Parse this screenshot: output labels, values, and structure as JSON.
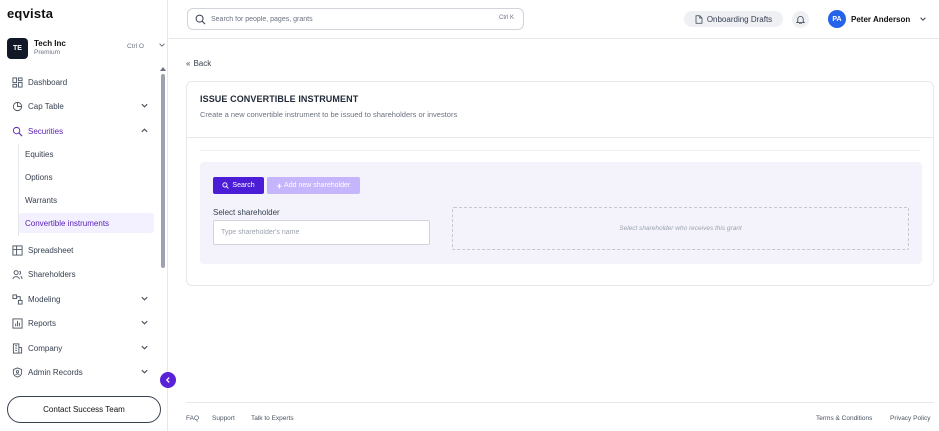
{
  "app": {
    "logo": "eqvista"
  },
  "org": {
    "initials": "TE",
    "name": "Tech Inc",
    "plan": "Premium",
    "shortcut": "Ctrl O"
  },
  "sidebar": {
    "items": [
      {
        "label": "Dashboard",
        "icon": "dashboard-icon"
      },
      {
        "label": "Cap Table",
        "icon": "pie-chart-icon"
      },
      {
        "label": "Securities",
        "icon": "securities-icon"
      },
      {
        "label": "Spreadsheet",
        "icon": "grid-icon"
      },
      {
        "label": "Shareholders",
        "icon": "users-icon"
      },
      {
        "label": "Modeling",
        "icon": "modeling-icon"
      },
      {
        "label": "Reports",
        "icon": "reports-icon"
      },
      {
        "label": "Company",
        "icon": "company-icon"
      },
      {
        "label": "Admin Records",
        "icon": "admin-icon"
      }
    ],
    "securities_sub": [
      "Equities",
      "Options",
      "Warrants",
      "Convertible instruments"
    ],
    "contact_label": "Contact Success Team"
  },
  "topbar": {
    "search_placeholder": "Search for people, pages, grants",
    "search_shortcut": "Ctrl K",
    "drafts_label": "Onboarding Drafts",
    "user_initials": "PA",
    "user_name": "Peter Anderson"
  },
  "main": {
    "back_label": "Back",
    "card": {
      "title": "ISSUE CONVERTIBLE INSTRUMENT",
      "subtitle": "Create a new convertible instrument to be issued to shareholders or investors",
      "search_label": "Search",
      "add_label": "Add new shareholder",
      "field_label": "Select shareholder",
      "field_placeholder": "Type shareholder's name",
      "dropzone_text": "Select shareholder who receives this grant"
    }
  },
  "footer": {
    "left_links": [
      "FAQ",
      "Support",
      "Talk to Experts"
    ],
    "right_links": [
      "Terms & Conditions",
      "Privacy Policy"
    ]
  },
  "colors": {
    "accent": "#4c1dd6",
    "accent_light": "#c4b5fd",
    "active_text": "#5b21b6",
    "panel_bg": "#f4f3fb"
  }
}
